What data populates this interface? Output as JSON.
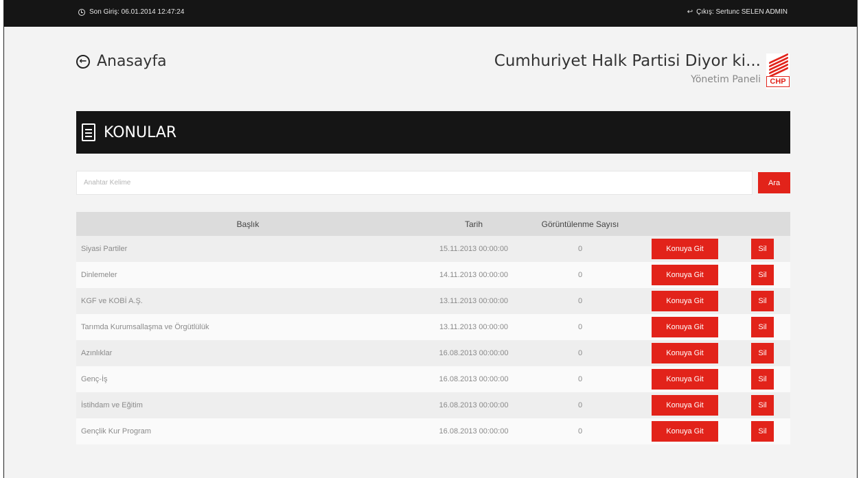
{
  "topbar": {
    "last_login": "Son Giriş: 06.01.2014 12:47:24",
    "logout": "Çıkış: Sertunc SELEN ADMIN"
  },
  "nav": {
    "home_label": "Anasayfa"
  },
  "brand": {
    "title": "Cumhuriyet Halk Partisi Diyor ki...",
    "subtitle": "Yönetim Paneli",
    "logo_text": "CHP",
    "accent_color": "#e2231a"
  },
  "section": {
    "title": "KONULAR"
  },
  "search": {
    "placeholder": "Anahtar Kelime",
    "button_label": "Ara"
  },
  "table": {
    "headers": {
      "title": "Başlık",
      "date": "Tarih",
      "views": "Görüntülenme Sayısı"
    },
    "goto_label": "Konuya Git",
    "delete_label": "Sil",
    "rows": [
      {
        "title": "Siyasi Partiler",
        "date": "15.11.2013 00:00:00",
        "views": "0"
      },
      {
        "title": "Dinlemeler",
        "date": "14.11.2013 00:00:00",
        "views": "0"
      },
      {
        "title": "KGF ve KOBİ A.Ş.",
        "date": "13.11.2013 00:00:00",
        "views": "0"
      },
      {
        "title": "Tarımda Kurumsallaşma ve Örgütlülük",
        "date": "13.11.2013 00:00:00",
        "views": "0"
      },
      {
        "title": "Azınlıklar",
        "date": "16.08.2013 00:00:00",
        "views": "0"
      },
      {
        "title": "Genç-İş",
        "date": "16.08.2013 00:00:00",
        "views": "0"
      },
      {
        "title": "İstihdam ve Eğitim",
        "date": "16.08.2013 00:00:00",
        "views": "0"
      },
      {
        "title": "Gençlik Kur Program",
        "date": "16.08.2013 00:00:00",
        "views": "0"
      }
    ]
  }
}
